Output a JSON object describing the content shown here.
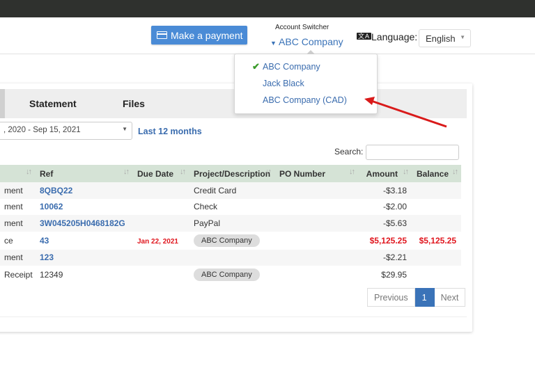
{
  "header": {
    "pay_button": "Make a payment",
    "account_switcher_label": "Account Switcher",
    "current_account": "ABC Company",
    "language_label": "Language:",
    "language_value": "English",
    "language_icon": "文A"
  },
  "account_dropdown": {
    "items": [
      {
        "label": "ABC Company",
        "selected": true
      },
      {
        "label": "Jack Black",
        "selected": false
      },
      {
        "label": "ABC Company (CAD)",
        "selected": false
      }
    ]
  },
  "tabs": [
    "Statement",
    "Files"
  ],
  "filters": {
    "date_range": ", 2020 - Sep 15, 2021",
    "preset_link": "Last 12 months",
    "search_label": "Search:",
    "search_value": ""
  },
  "table": {
    "columns": [
      "",
      "Ref",
      "Due Date",
      "Project/Description",
      "PO Number",
      "Amount",
      "Balance"
    ],
    "rows": [
      {
        "type": "ment",
        "ref": "8QBQ22",
        "due": "",
        "project": "Credit Card",
        "po": "",
        "amount": "-$3.18",
        "balance": ""
      },
      {
        "type": "ment",
        "ref": "10062",
        "due": "",
        "project": "Check",
        "po": "",
        "amount": "-$2.00",
        "balance": ""
      },
      {
        "type": "ment",
        "ref": "3W045205H0468182G",
        "due": "",
        "project": "PayPal",
        "po": "",
        "amount": "-$5.63",
        "balance": ""
      },
      {
        "type": "ce",
        "ref": "43",
        "due": "Jan 22, 2021",
        "project": "ABC Company",
        "po": "",
        "amount": "$5,125.25",
        "balance": "$5,125.25"
      },
      {
        "type": "ment",
        "ref": "123",
        "due": "",
        "project": "",
        "po": "",
        "amount": "-$2.21",
        "balance": ""
      },
      {
        "type": " Receipt",
        "ref": "12349",
        "due": "",
        "project": "ABC Company",
        "po": "",
        "amount": "$29.95",
        "balance": ""
      }
    ]
  },
  "pagination": {
    "previous": "Previous",
    "current": "1",
    "next": "Next"
  },
  "colors": {
    "accent": "#3a73b8",
    "overdue": "#e0161e",
    "annotation_arrow": "#d91a1a"
  }
}
